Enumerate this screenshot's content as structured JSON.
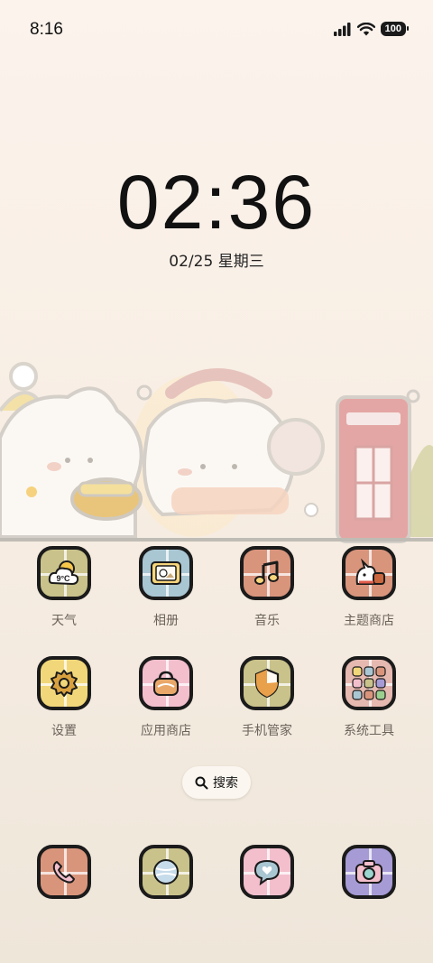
{
  "status_bar": {
    "time": "8:16",
    "signal_icon": "cellular-signal-icon",
    "wifi_icon": "wifi-icon",
    "battery": "100"
  },
  "lock_clock": {
    "time": "02:36",
    "date": "02/25 星期三"
  },
  "apps": [
    {
      "label": "天气",
      "icon": "weather-icon",
      "bg": "#c9c28a",
      "glyph": "9°C"
    },
    {
      "label": "相册",
      "icon": "gallery-icon",
      "bg": "#a9c6d3"
    },
    {
      "label": "音乐",
      "icon": "music-icon",
      "bg": "#d9957c"
    },
    {
      "label": "主题商店",
      "icon": "themes-icon",
      "bg": "#d9957c"
    },
    {
      "label": "设置",
      "icon": "settings-icon",
      "bg": "#f1d779"
    },
    {
      "label": "应用商店",
      "icon": "app-store-icon",
      "bg": "#f3bfcd"
    },
    {
      "label": "手机管家",
      "icon": "security-icon",
      "bg": "#c9c28a"
    },
    {
      "label": "系统工具",
      "icon": "system-tools-icon",
      "bg": "#7d6a5a"
    }
  ],
  "search": {
    "label": "搜索",
    "icon": "search-icon"
  },
  "dock": [
    {
      "icon": "phone-icon",
      "bg": "#d9957c"
    },
    {
      "icon": "browser-icon",
      "bg": "#c9c28a"
    },
    {
      "icon": "messages-icon",
      "bg": "#f3bfcd"
    },
    {
      "icon": "camera-icon",
      "bg": "#a79bd6"
    }
  ]
}
